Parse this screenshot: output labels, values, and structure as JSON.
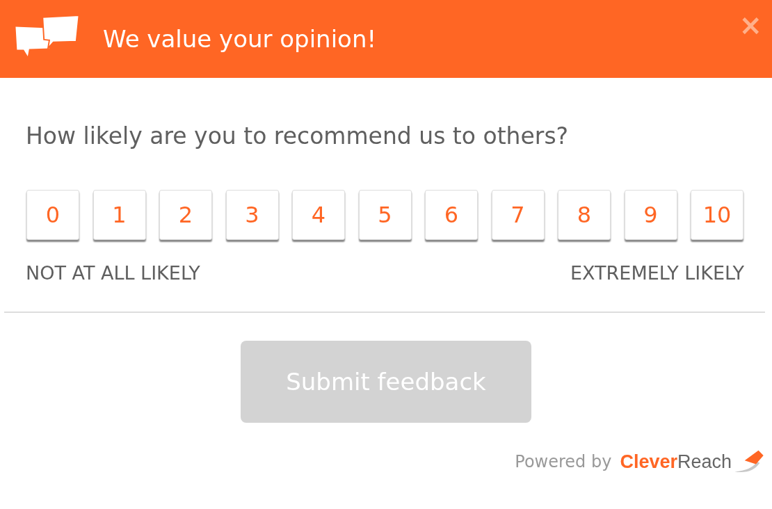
{
  "header": {
    "title": "We value your opinion!",
    "close": "×"
  },
  "question": "How likely are you to recommend us to others?",
  "scale": [
    {
      "label": "0",
      "selected": false
    },
    {
      "label": "1",
      "selected": false
    },
    {
      "label": "2",
      "selected": false
    },
    {
      "label": "3",
      "selected": false
    },
    {
      "label": "4",
      "selected": false
    },
    {
      "label": "5",
      "selected": false
    },
    {
      "label": "6",
      "selected": false
    },
    {
      "label": "7",
      "selected": false
    },
    {
      "label": "8",
      "selected": false
    },
    {
      "label": "9",
      "selected": false
    },
    {
      "label": "10",
      "selected": false
    }
  ],
  "scale_labels": {
    "low": "NOT AT ALL LIKELY",
    "high": "EXTREMELY LIKELY"
  },
  "submit": {
    "label": "Submit feedback",
    "disabled": true
  },
  "footer": {
    "powered_by": "Powered by",
    "logo": "**Clever**Reach"
  }
}
